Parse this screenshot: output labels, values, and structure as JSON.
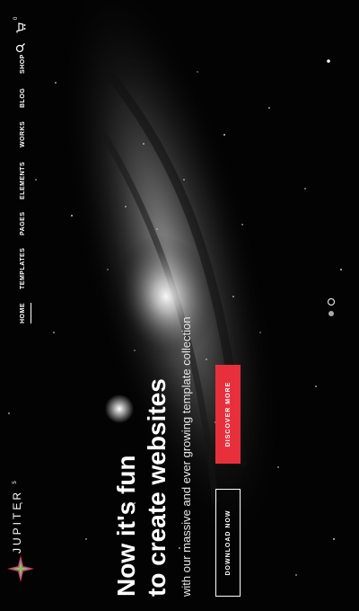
{
  "brand": {
    "name": "JUPITER",
    "version": "5"
  },
  "nav": {
    "items": [
      {
        "label": "HOME",
        "active": true
      },
      {
        "label": "TEMPLATES",
        "active": false
      },
      {
        "label": "PAGES",
        "active": false
      },
      {
        "label": "ELEMENTS",
        "active": false
      },
      {
        "label": "WORKS",
        "active": false
      },
      {
        "label": "BLOG",
        "active": false
      },
      {
        "label": "SHOP",
        "active": false
      }
    ],
    "cart_count": "0",
    "icons": [
      "search-icon",
      "cart-icon"
    ]
  },
  "hero": {
    "title_line1": "Now it's fun",
    "title_line2": "to create websites",
    "subtitle": "with our massive and ever growing template collection",
    "download_label": "DOWNLOAD NOW",
    "discover_label": "DISCOVER MORE"
  },
  "slider": {
    "current": 2,
    "total": 2
  },
  "colors": {
    "accent": "#e8303c",
    "background": "#000000",
    "text": "#ffffff"
  }
}
